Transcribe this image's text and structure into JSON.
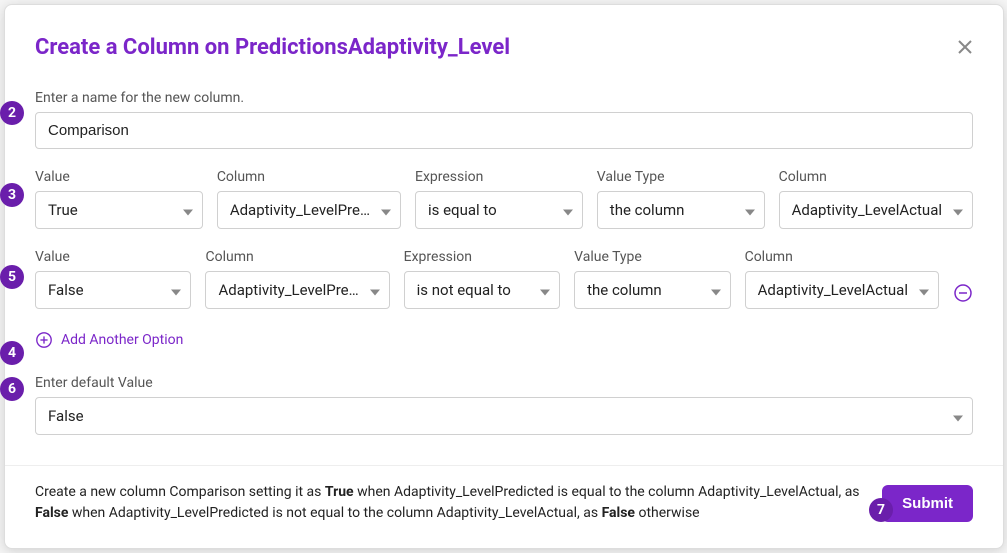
{
  "title": "Create a Column on PredictionsAdaptivity_Level",
  "name_label": "Enter a name for the new column.",
  "name_value": "Comparison",
  "col_labels": {
    "value": "Value",
    "column": "Column",
    "expression": "Expression",
    "value_type": "Value Type",
    "column2": "Column"
  },
  "rows": [
    {
      "value": "True",
      "column": "Adaptivity_LevelPre…",
      "expression": "is equal to",
      "value_type": "the column",
      "column2": "Adaptivity_LevelActual"
    },
    {
      "value": "False",
      "column": "Adaptivity_LevelPre…",
      "expression": "is not equal to",
      "value_type": "the column",
      "column2": "Adaptivity_LevelActual"
    }
  ],
  "add_option": "Add Another Option",
  "default_label": "Enter default Value",
  "default_value": "False",
  "summary_parts": {
    "p1": "Create a new column Comparison setting it as ",
    "b1": "True",
    "p2": " when Adaptivity_LevelPredicted is equal to the column Adaptivity_LevelActual, as ",
    "b2": "False",
    "p3": " when Adaptivity_LevelPredicted is not equal to the column Adaptivity_LevelActual, as ",
    "b3": "False",
    "p4": " otherwise"
  },
  "submit": "Submit",
  "badges": {
    "b2": "2",
    "b3": "3",
    "b4": "4",
    "b5": "5",
    "b6": "6",
    "b7": "7"
  }
}
